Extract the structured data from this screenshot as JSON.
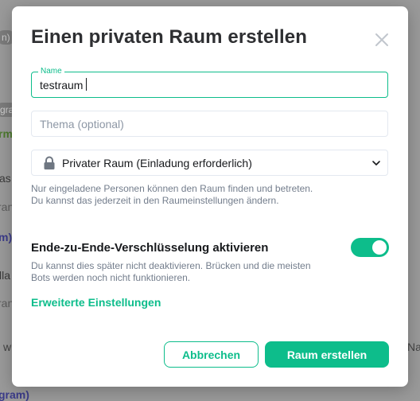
{
  "background": {
    "fragments": [
      "m)",
      "gra",
      "rm)",
      "as",
      "ran",
      "m)",
      "lla",
      "ran",
      "w",
      "Na",
      "gram)"
    ],
    "chip": "n)"
  },
  "dialog": {
    "title": "Einen privaten Raum erstellen",
    "close_icon": "close-icon",
    "name_field": {
      "label": "Name",
      "value": "testraum"
    },
    "topic_field": {
      "placeholder": "Thema (optional)",
      "value": ""
    },
    "visibility_select": {
      "selected": "Privater Raum (Einladung erforderlich)",
      "icon": "lock-icon"
    },
    "visibility_hint": "Nur eingeladene Personen können den Raum finden und betreten. Du kannst das jederzeit in den Raumeinstellungen ändern.",
    "e2e": {
      "label": "Ende-zu-Ende-Verschlüsselung aktivieren",
      "enabled": true,
      "hint": "Du kannst dies später nicht deaktivieren. Brücken und die meisten Bots werden noch nicht funktionieren."
    },
    "advanced_link": "Erweiterte Einstellungen",
    "cancel_label": "Abbrechen",
    "create_label": "Raum erstellen"
  },
  "colors": {
    "accent": "#0dbd8b",
    "text": "#17191c",
    "muted": "#737d8c"
  }
}
